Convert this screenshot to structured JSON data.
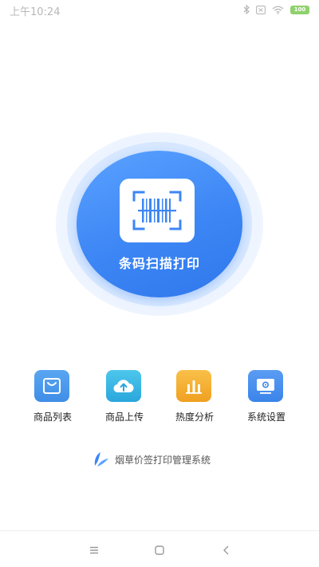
{
  "status_bar": {
    "time": "上午10:24",
    "battery": "100",
    "icons": [
      "bluetooth-icon",
      "sim-icon",
      "wifi-icon",
      "battery-icon"
    ]
  },
  "scan": {
    "label": "条码扫描打印",
    "icon": "barcode-scan-icon",
    "color": "#3d86f5"
  },
  "features": [
    {
      "label": "商品列表",
      "icon": "shopping-bag-icon",
      "color": "#3f8ee6"
    },
    {
      "label": "商品上传",
      "icon": "cloud-upload-icon",
      "color": "#33b3e0"
    },
    {
      "label": "热度分析",
      "icon": "bar-chart-icon",
      "color": "#f4ad2c"
    },
    {
      "label": "系统设置",
      "icon": "monitor-settings-icon",
      "color": "#3a84ea"
    }
  ],
  "brand": {
    "text": "烟草价签打印管理系统",
    "icon": "leaf-logo-icon"
  },
  "nav": {
    "icons": [
      "menu-icon",
      "home-icon",
      "back-icon"
    ]
  }
}
